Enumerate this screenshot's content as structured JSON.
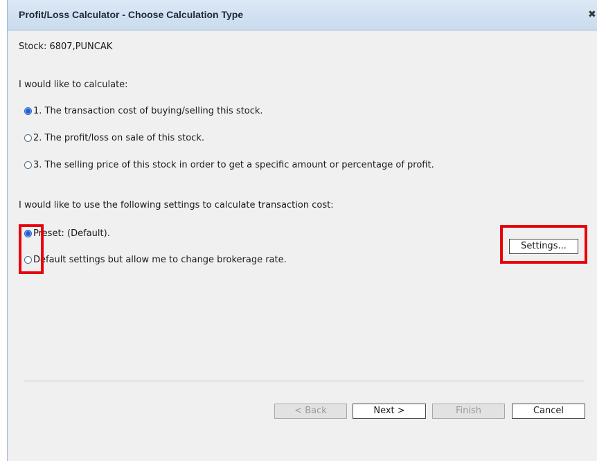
{
  "window": {
    "title": "Profit/Loss Calculator - Choose Calculation Type",
    "close_icon": "close-icon"
  },
  "stock_line": "Stock: 6807,PUNCAK",
  "calc_section": {
    "heading": "I would like to calculate:",
    "options": [
      {
        "label": "1. The transaction cost of buying/selling this stock.",
        "checked": true
      },
      {
        "label": "2. The profit/loss on sale of this stock.",
        "checked": false
      },
      {
        "label": "3. The selling price of this stock in order to get a specific amount or percentage of profit.",
        "checked": false
      }
    ]
  },
  "settings_section": {
    "heading": "I would like to use the following settings to calculate transaction cost:",
    "options": [
      {
        "label": "Preset: (Default).",
        "checked": true
      },
      {
        "label": "Default settings but allow me to change brokerage rate.",
        "checked": false
      }
    ],
    "settings_button": "Settings..."
  },
  "footer": {
    "back": "< Back",
    "next": "Next >",
    "finish": "Finish",
    "cancel": "Cancel"
  },
  "colors": {
    "highlight": "#e8000b",
    "radio_selected": "#1e5fd8"
  }
}
